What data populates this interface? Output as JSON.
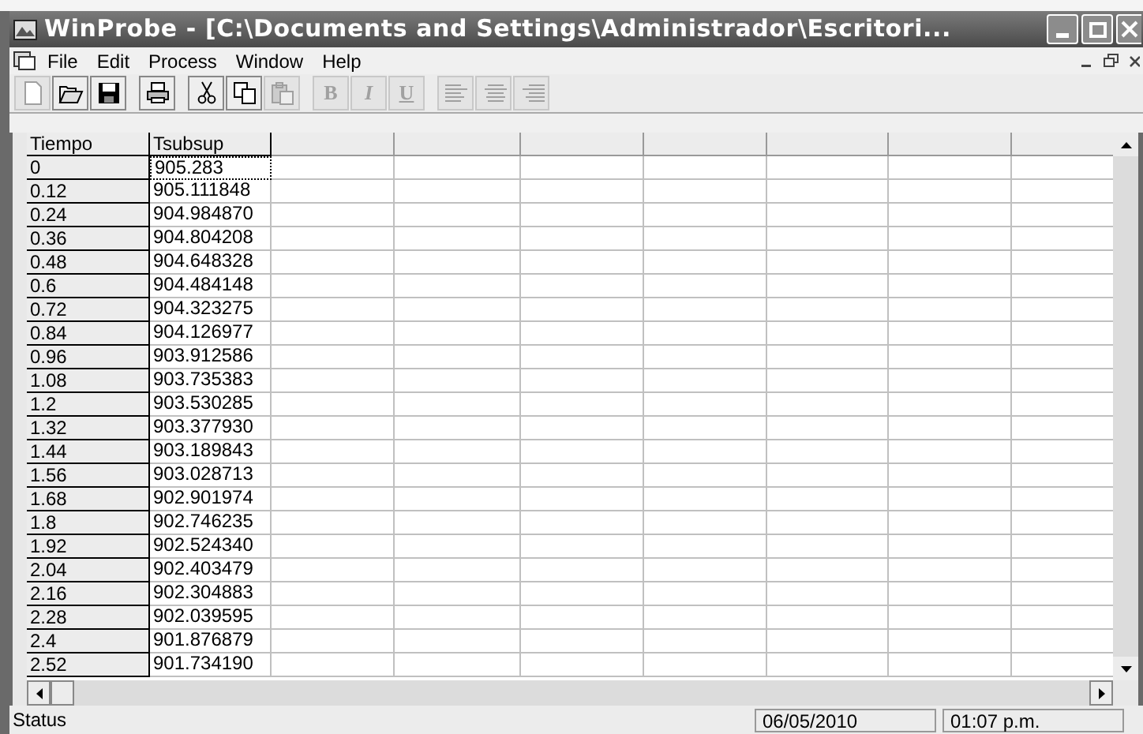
{
  "window": {
    "title": "WinProbe - [C:\\Documents and Settings\\Administrador\\Escritori..."
  },
  "menu": [
    "File",
    "Edit",
    "Process",
    "Window",
    "Help"
  ],
  "toolbar": [
    {
      "kind": "new",
      "disabled": true
    },
    {
      "kind": "open",
      "disabled": false
    },
    {
      "kind": "save",
      "disabled": false
    },
    {
      "kind": "print",
      "disabled": false
    },
    {
      "kind": "cut",
      "disabled": false
    },
    {
      "kind": "copy",
      "disabled": false
    },
    {
      "kind": "paste",
      "disabled": true
    },
    {
      "kind": "bold",
      "label": "B",
      "disabled": true
    },
    {
      "kind": "italic",
      "label": "I",
      "disabled": true
    },
    {
      "kind": "underline",
      "label": "U",
      "disabled": true
    },
    {
      "kind": "align-left",
      "disabled": true
    },
    {
      "kind": "align-center",
      "disabled": true
    },
    {
      "kind": "align-right",
      "disabled": true
    }
  ],
  "table": {
    "columns": [
      "Tiempo",
      "Tsubsup"
    ],
    "rows": [
      {
        "cells": [
          "0",
          "905.283"
        ],
        "selected": true
      },
      {
        "cells": [
          "0.12",
          "905.111848"
        ],
        "selected": false
      },
      {
        "cells": [
          "0.24",
          "904.984870"
        ],
        "selected": false
      },
      {
        "cells": [
          "0.36",
          "904.804208"
        ],
        "selected": false
      },
      {
        "cells": [
          "0.48",
          "904.648328"
        ],
        "selected": false
      },
      {
        "cells": [
          "0.6",
          "904.484148"
        ],
        "selected": false
      },
      {
        "cells": [
          "0.72",
          "904.323275"
        ],
        "selected": false
      },
      {
        "cells": [
          "0.84",
          "904.126977"
        ],
        "selected": false
      },
      {
        "cells": [
          "0.96",
          "903.912586"
        ],
        "selected": false
      },
      {
        "cells": [
          "1.08",
          "903.735383"
        ],
        "selected": false
      },
      {
        "cells": [
          "1.2",
          "903.530285"
        ],
        "selected": false
      },
      {
        "cells": [
          "1.32",
          "903.377930"
        ],
        "selected": false
      },
      {
        "cells": [
          "1.44",
          "903.189843"
        ],
        "selected": false
      },
      {
        "cells": [
          "1.56",
          "903.028713"
        ],
        "selected": false
      },
      {
        "cells": [
          "1.68",
          "902.901974"
        ],
        "selected": false
      },
      {
        "cells": [
          "1.8",
          "902.746235"
        ],
        "selected": false
      },
      {
        "cells": [
          "1.92",
          "902.524340"
        ],
        "selected": false
      },
      {
        "cells": [
          "2.04",
          "902.403479"
        ],
        "selected": false
      },
      {
        "cells": [
          "2.16",
          "902.304883"
        ],
        "selected": false
      },
      {
        "cells": [
          "2.28",
          "902.039595"
        ],
        "selected": false
      },
      {
        "cells": [
          "2.4",
          "901.876879"
        ],
        "selected": false
      },
      {
        "cells": [
          "2.52",
          "901.734190"
        ],
        "selected": false
      }
    ]
  },
  "status_bar": {
    "message": "Status",
    "date": "06/05/2010",
    "time": "01:07 p.m."
  }
}
